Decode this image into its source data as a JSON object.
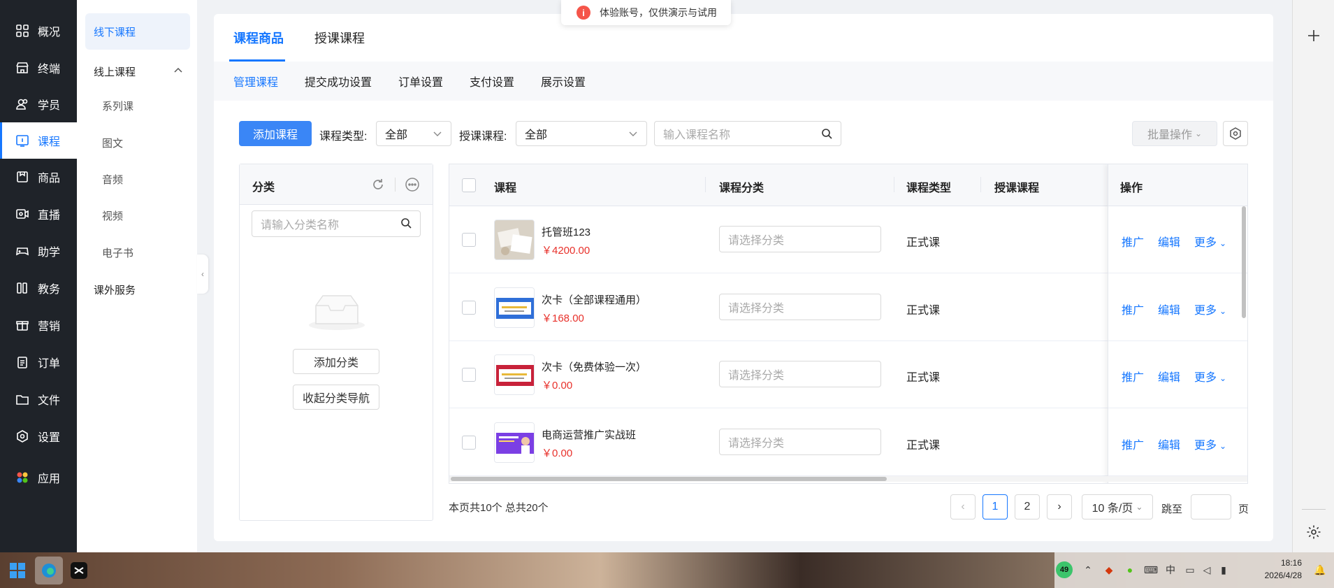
{
  "toast": {
    "text": "体验账号，仅供演示与试用"
  },
  "nav": {
    "items": [
      {
        "label": "概况"
      },
      {
        "label": "终端"
      },
      {
        "label": "学员"
      },
      {
        "label": "课程"
      },
      {
        "label": "商品"
      },
      {
        "label": "直播"
      },
      {
        "label": "助学"
      },
      {
        "label": "教务"
      },
      {
        "label": "营销"
      },
      {
        "label": "订单"
      },
      {
        "label": "文件"
      },
      {
        "label": "设置"
      },
      {
        "label": "应用"
      }
    ],
    "active": "课程"
  },
  "subnav": {
    "items": [
      {
        "label": "线下课程"
      },
      {
        "label": "线上课程"
      },
      {
        "label": "系列课"
      },
      {
        "label": "图文"
      },
      {
        "label": "音频"
      },
      {
        "label": "视频"
      },
      {
        "label": "电子书"
      },
      {
        "label": "课外服务"
      }
    ],
    "active": "线下课程"
  },
  "tabs_primary": [
    "课程商品",
    "授课课程"
  ],
  "tabs_secondary": [
    "管理课程",
    "提交成功设置",
    "订单设置",
    "支付设置",
    "展示设置"
  ],
  "toolbar": {
    "add_course": "添加课程",
    "course_type_label": "课程类型:",
    "course_type_value": "全部",
    "teaching_course_label": "授课课程:",
    "teaching_course_value": "全部",
    "search_placeholder": "输入课程名称",
    "batch_label": "批量操作"
  },
  "category_panel": {
    "title": "分类",
    "search_placeholder": "请输入分类名称",
    "add_label": "添加分类",
    "collapse_label": "收起分类导航"
  },
  "table": {
    "headers": {
      "course": "课程",
      "category": "课程分类",
      "type": "课程类型",
      "teaching": "授课课程",
      "actions": "操作"
    },
    "rows": [
      {
        "name": "托管班123",
        "price": "￥4200.00",
        "category_placeholder": "请选择分类",
        "type": "正式课"
      },
      {
        "name": "次卡（全部课程通用）",
        "price": "￥168.00",
        "category_placeholder": "请选择分类",
        "type": "正式课"
      },
      {
        "name": "次卡（免费体验一次）",
        "price": "￥0.00",
        "category_placeholder": "请选择分类",
        "type": "正式课"
      },
      {
        "name": "电商运营推广实战班",
        "price": "￥0.00",
        "category_placeholder": "请选择分类",
        "type": "正式课"
      }
    ],
    "actions": {
      "promote": "推广",
      "edit": "编辑",
      "more": "更多"
    }
  },
  "pagination": {
    "summary": "本页共10个 总共20个",
    "pages": [
      "1",
      "2"
    ],
    "current": "1",
    "page_size": "10 条/页",
    "jump_label": "跳至",
    "page_unit": "页"
  },
  "taskbar": {
    "time": "18:16",
    "date": "2026/4/28",
    "badge": "49",
    "ime": "中"
  },
  "colors": {
    "accent": "#1677ff",
    "nav_bg": "#1f2329",
    "price": "#e8312b"
  }
}
